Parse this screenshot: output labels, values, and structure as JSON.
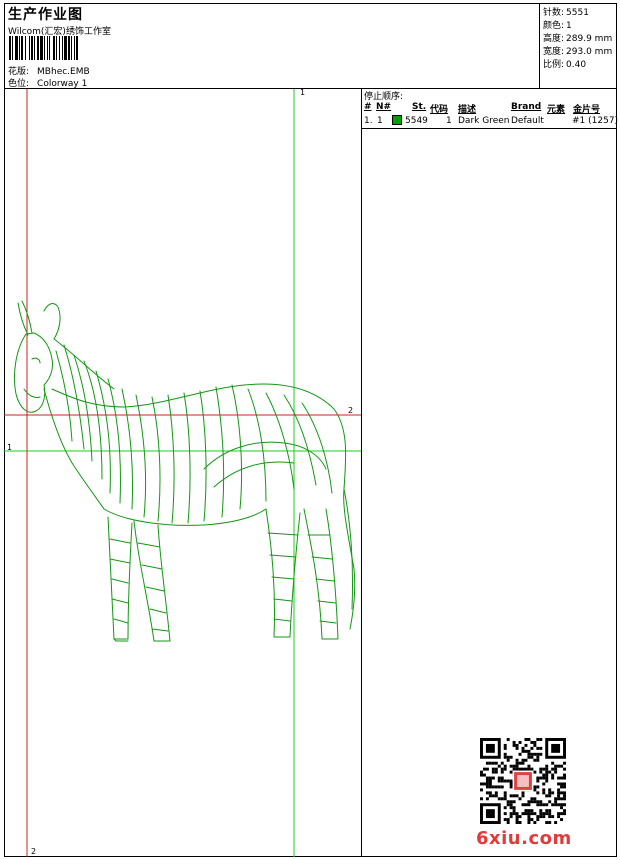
{
  "header": {
    "title": "生产作业图",
    "company": "Wilcom(汇宏)绣饰工作室",
    "design_label": "花版:",
    "design_value": "MBhec.EMB",
    "colorway_label": "色位:",
    "colorway_value": "Colorway 1"
  },
  "stats": [
    {
      "label": "针数:",
      "value": "5551"
    },
    {
      "label": "颜色:",
      "value": "1"
    },
    {
      "label": "高度:",
      "value": "289.9 mm"
    },
    {
      "label": "宽度:",
      "value": "293.0 mm"
    },
    {
      "label": "比例:",
      "value": "0.40"
    }
  ],
  "guides": {
    "v_green": "1",
    "h_green": "1",
    "h_red": "2",
    "v_red": "2"
  },
  "stop_sequence": {
    "title": "停止顺序:",
    "headers": {
      "num": "#",
      "n": "N#",
      "st": "St.",
      "code": "代码",
      "desc": "描述",
      "brand": "Brand",
      "elem": "元素",
      "seq": "金片号"
    },
    "rows": [
      {
        "num": "1.",
        "n": "1",
        "st": "5549",
        "code": "1",
        "desc": "Dark Green",
        "brand": "Default",
        "seq": "#1 (1257)",
        "color": "#00a000"
      }
    ]
  },
  "watermark": "6xiu.com",
  "colors": {
    "stitch": "#149614",
    "guide_green": "#22cc22",
    "guide_red": "#cc2222"
  }
}
